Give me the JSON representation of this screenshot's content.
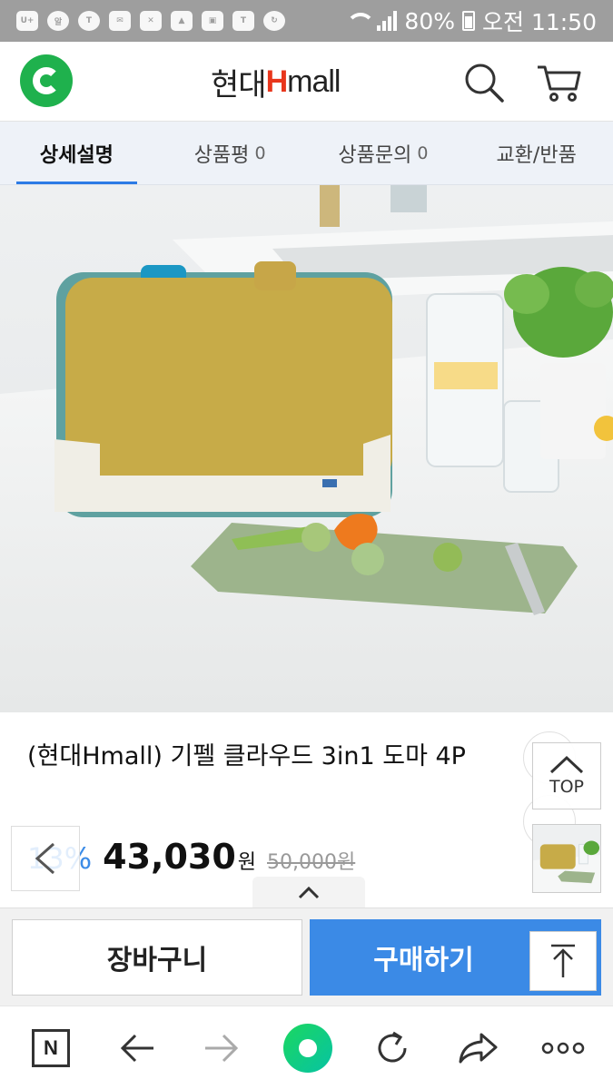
{
  "status_bar": {
    "left_icons": [
      "U+",
      "알림",
      "TALK",
      "mail",
      "missed-call",
      "gallery",
      "screenshot",
      "T",
      "sync"
    ],
    "battery": "80%",
    "time": "오전 11:50"
  },
  "header": {
    "brand_prefix": "현대",
    "brand_h": "H",
    "brand_suffix": "mall"
  },
  "tabs": [
    {
      "label": "상세설명",
      "count": ""
    },
    {
      "label": "상품평",
      "count": "0"
    },
    {
      "label": "상품문의",
      "count": "0"
    },
    {
      "label": "교환/반품",
      "count": ""
    }
  ],
  "product": {
    "title": "(현대Hmall) 기펠 클라우드 3in1 도마 4P",
    "discount": "13%",
    "price": "43,030",
    "price_unit": "원",
    "original_price": "50,000원"
  },
  "floating": {
    "top_label": "TOP"
  },
  "actions": {
    "cart_label": "장바구니",
    "buy_label": "구매하기"
  },
  "colors": {
    "accent": "#3b8ae6",
    "brand_red": "#e8361c",
    "logo_green": "#1fb14d",
    "status_bar": "#9e9e9e"
  }
}
